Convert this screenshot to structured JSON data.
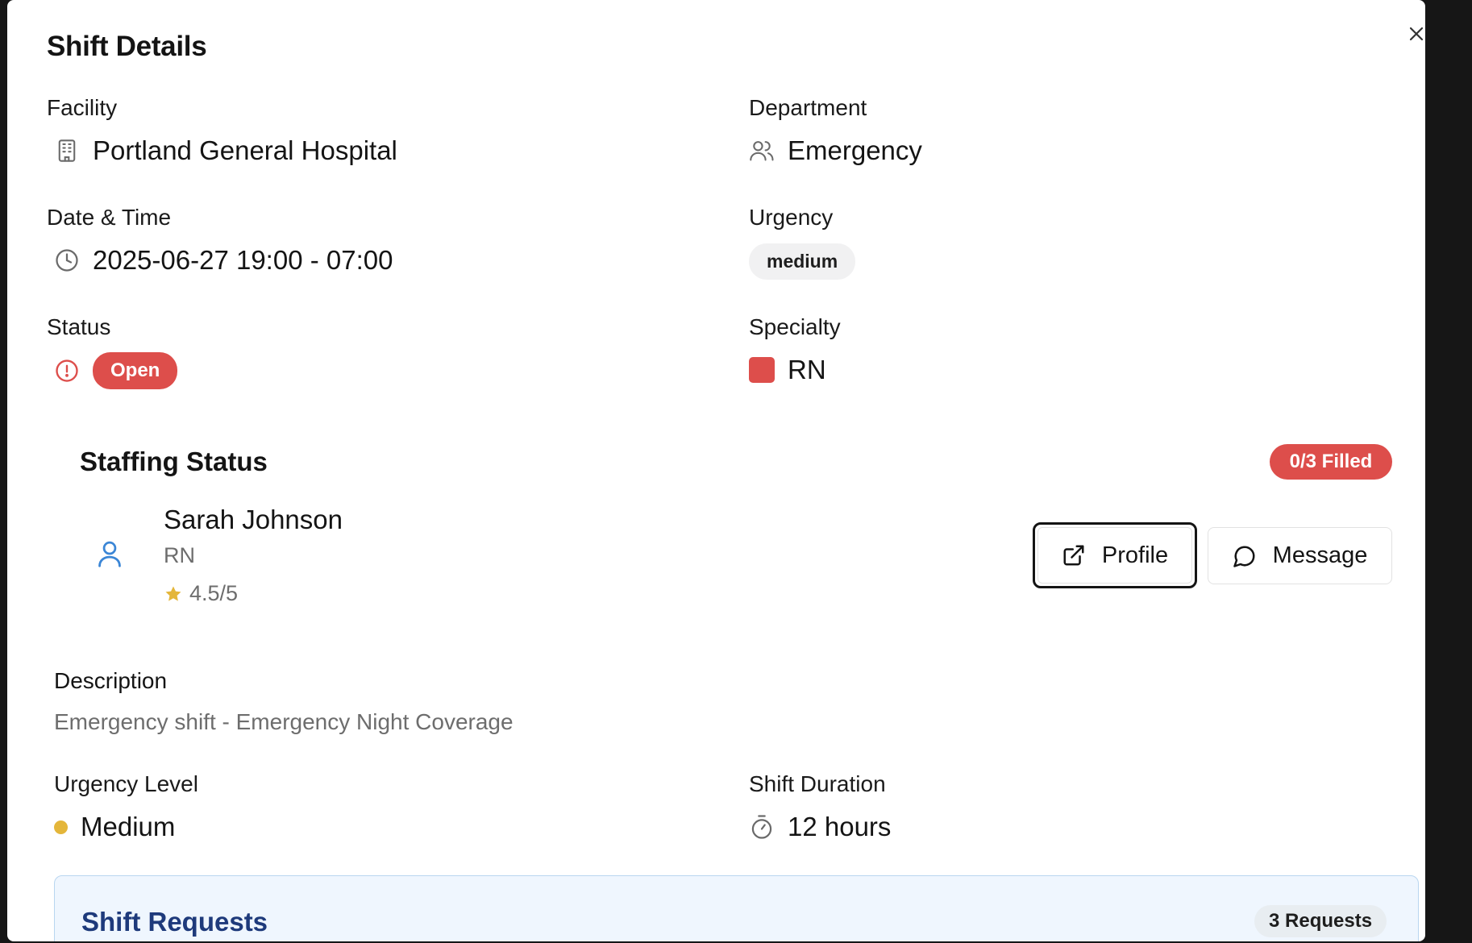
{
  "dialog": {
    "title": "Shift Details",
    "close_icon": "x-icon"
  },
  "fields": {
    "facility": {
      "label": "Facility",
      "value": "Portland General Hospital",
      "icon": "building-icon"
    },
    "department": {
      "label": "Department",
      "value": "Emergency",
      "icon": "users-icon"
    },
    "datetime": {
      "label": "Date & Time",
      "value": "2025-06-27 19:00 - 07:00",
      "icon": "clock-icon"
    },
    "urgency": {
      "label": "Urgency",
      "value": "medium"
    },
    "status": {
      "label": "Status",
      "value": "Open",
      "icon": "alert-circle-icon"
    },
    "specialty": {
      "label": "Specialty",
      "value": "RN",
      "color": "#dd4e4b"
    }
  },
  "staffing": {
    "title": "Staffing Status",
    "filled_badge": "0/3 Filled",
    "assignee": {
      "name": "Sarah Johnson",
      "role": "RN",
      "rating": "4.5/5",
      "icon": "user-icon"
    },
    "profile_button": "Profile",
    "message_button": "Message"
  },
  "description": {
    "label": "Description",
    "text": "Emergency shift - Emergency Night Coverage"
  },
  "urgency_level": {
    "label": "Urgency Level",
    "value": "Medium",
    "dot_color": "#e4b63a"
  },
  "shift_duration": {
    "label": "Shift Duration",
    "value": "12 hours",
    "icon": "timer-icon"
  },
  "requests": {
    "title": "Shift Requests",
    "badge": "3 Requests"
  },
  "colors": {
    "danger": "#dd4e4b",
    "accent_blue": "#1e3a7b",
    "star": "#e4b63a"
  }
}
